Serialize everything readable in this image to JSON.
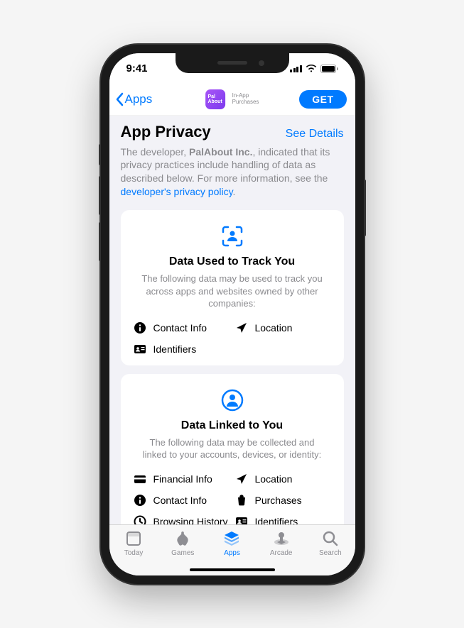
{
  "status": {
    "time": "9:41"
  },
  "nav": {
    "back": "Apps",
    "app_name": "Pal\nAbout",
    "iap": "In-App\nPurchases",
    "get": "GET"
  },
  "header": {
    "title": "App Privacy",
    "details": "See Details"
  },
  "desc": {
    "prefix": "The developer, ",
    "dev": "PalAbout Inc.",
    "mid": ", indicated that its privacy practices include handling of data as described below. For more information, see the ",
    "link": "developer's privacy policy",
    "suffix": "."
  },
  "card1": {
    "title": "Data Used to Track You",
    "desc": "The following data may be used to track you across apps and websites owned by other companies:",
    "items": [
      {
        "icon": "info",
        "label": "Contact Info"
      },
      {
        "icon": "location",
        "label": "Location"
      },
      {
        "icon": "id",
        "label": "Identifiers"
      }
    ]
  },
  "card2": {
    "title": "Data Linked to You",
    "desc": "The following data may be collected and linked to your accounts, devices, or identity:",
    "items": [
      {
        "icon": "financial",
        "label": "Financial Info"
      },
      {
        "icon": "location",
        "label": "Location"
      },
      {
        "icon": "info",
        "label": "Contact Info"
      },
      {
        "icon": "purchases",
        "label": "Purchases"
      },
      {
        "icon": "history",
        "label": "Browsing History"
      },
      {
        "icon": "id",
        "label": "Identifiers"
      }
    ]
  },
  "tabs": [
    {
      "icon": "today",
      "label": "Today"
    },
    {
      "icon": "games",
      "label": "Games"
    },
    {
      "icon": "apps",
      "label": "Apps",
      "active": true
    },
    {
      "icon": "arcade",
      "label": "Arcade"
    },
    {
      "icon": "search",
      "label": "Search"
    }
  ]
}
